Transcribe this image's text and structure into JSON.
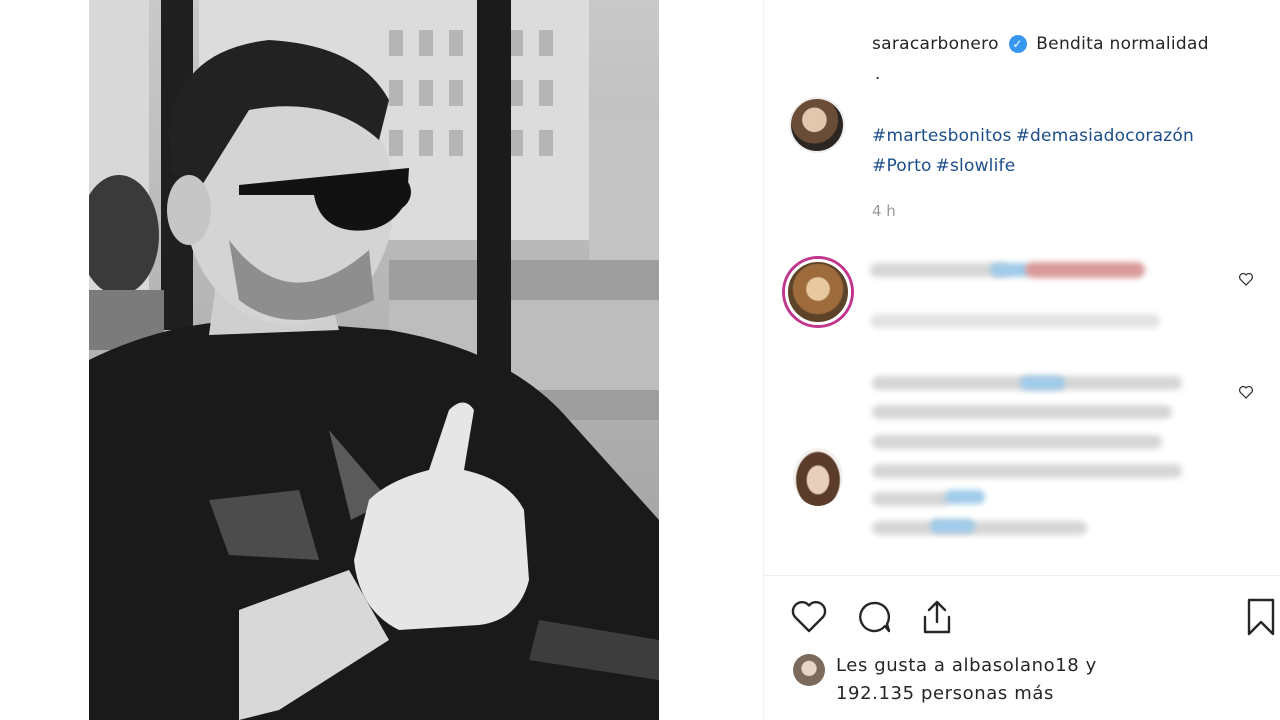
{
  "post": {
    "username": "saracarbonero",
    "verified_glyph": "✓",
    "caption_text": "Bendita normalidad",
    "caption_dot": ".",
    "hashtags": [
      "#martesbonitos",
      "#demasiadocorazón",
      "#Porto",
      "#slowlife"
    ],
    "timestamp": "4 h"
  },
  "likes": {
    "prefix": "Les gusta a",
    "user": "albasolano18",
    "joiner": "y",
    "count": "192.135",
    "suffix": "personas más"
  },
  "icons": {
    "like": "heart-outline-icon",
    "comment": "comment-bubble-icon",
    "share": "share-upload-icon",
    "save": "bookmark-icon",
    "comment_like": "small-heart-icon"
  },
  "colors": {
    "hashtag": "#1b4d8a",
    "verified": "#3897f0",
    "story_ring": "#c1358f",
    "timestamp": "#999999"
  }
}
